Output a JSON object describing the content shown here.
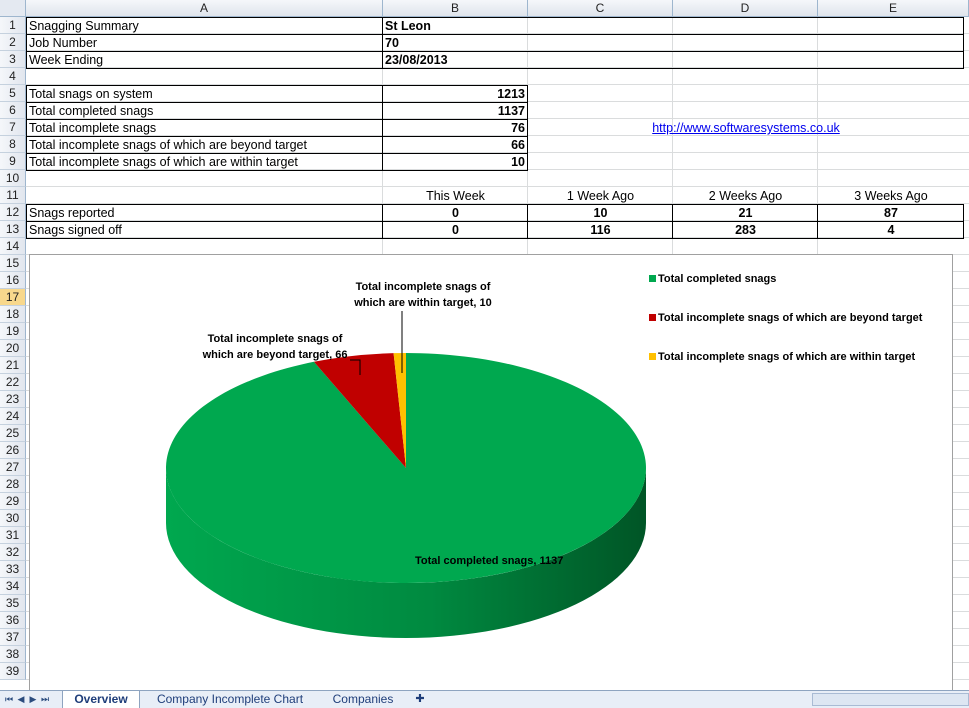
{
  "columns": [
    "A",
    "B",
    "C",
    "D",
    "E"
  ],
  "rows": [
    "1",
    "2",
    "3",
    "4",
    "5",
    "6",
    "7",
    "8",
    "9",
    "10",
    "11",
    "12",
    "13",
    "14",
    "15",
    "16",
    "17",
    "18",
    "19",
    "20",
    "21",
    "22",
    "23",
    "24",
    "25",
    "26",
    "27",
    "28",
    "29",
    "30",
    "31",
    "32",
    "33",
    "34",
    "35",
    "36",
    "37",
    "38",
    "39"
  ],
  "selected_row": "17",
  "header": {
    "summary_label": "Snagging Summary",
    "summary_value": "St Leon",
    "job_label": "Job Number",
    "job_value": "70",
    "week_label": "Week Ending",
    "week_value": "23/08/2013"
  },
  "totals": [
    {
      "label": "Total snags on system",
      "value": "1213"
    },
    {
      "label": "Total completed snags",
      "value": "1137"
    },
    {
      "label": "Total incomplete snags",
      "value": "76"
    },
    {
      "label": "Total incomplete snags of which are beyond target",
      "value": "66"
    },
    {
      "label": "Total incomplete snags of which are within target",
      "value": "10"
    }
  ],
  "link": "http://www.softwaresystems.co.uk",
  "weekly": {
    "headers": [
      "This Week",
      "1 Week Ago",
      "2 Weeks Ago",
      "3 Weeks Ago"
    ],
    "rows": [
      {
        "label": "Snags reported",
        "values": [
          "0",
          "10",
          "21",
          "87"
        ]
      },
      {
        "label": "Snags signed off",
        "values": [
          "0",
          "116",
          "283",
          "4"
        ]
      }
    ]
  },
  "chart_data": {
    "type": "pie",
    "title": "",
    "legend_position": "top-right",
    "slices": [
      {
        "label": "Total completed snags",
        "value": 1137,
        "color": "#00a84f",
        "data_label": "Total completed snags,  1137"
      },
      {
        "label": "Total incomplete snags of which are beyond target",
        "value": 66,
        "color": "#c00000",
        "data_label_lines": [
          "Total incomplete snags of",
          "which are beyond target, 66"
        ]
      },
      {
        "label": "Total incomplete snags of which are within target",
        "value": 10,
        "color": "#ffc000",
        "data_label_lines": [
          "Total incomplete snags of",
          "which are within target, 10"
        ]
      }
    ]
  },
  "tabs": [
    "Overview",
    "Company Incomplete Chart",
    "Companies"
  ],
  "active_tab": "Overview",
  "nav_icons": [
    "first-sheet-icon",
    "prev-sheet-icon",
    "next-sheet-icon",
    "last-sheet-icon",
    "insert-sheet-icon"
  ]
}
